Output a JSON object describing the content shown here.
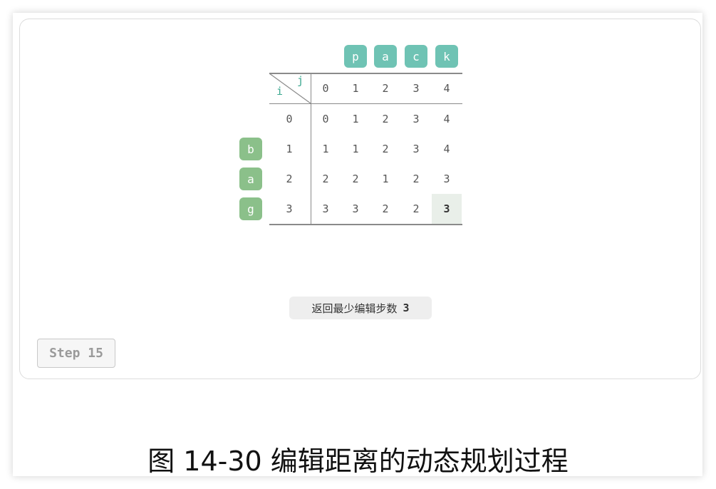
{
  "target_chars": [
    "p",
    "a",
    "c",
    "k"
  ],
  "source_chars": [
    "b",
    "a",
    "g"
  ],
  "corner": {
    "col_label": "j",
    "row_label": "i"
  },
  "col_indices": [
    "0",
    "1",
    "2",
    "3",
    "4"
  ],
  "row_indices": [
    "0",
    "1",
    "2",
    "3"
  ],
  "dp": [
    [
      "0",
      "1",
      "2",
      "3",
      "4"
    ],
    [
      "1",
      "1",
      "2",
      "3",
      "4"
    ],
    [
      "2",
      "2",
      "1",
      "2",
      "3"
    ],
    [
      "3",
      "3",
      "2",
      "2",
      "3"
    ]
  ],
  "result": {
    "label": "返回最少编辑步数",
    "value": "3"
  },
  "step_label": "Step 15",
  "caption": "图 14-30   编辑距离的动态规划过程",
  "colors": {
    "teal": "#6fc3b4",
    "green": "#8bc08a",
    "highlight": "#e9efe9"
  }
}
